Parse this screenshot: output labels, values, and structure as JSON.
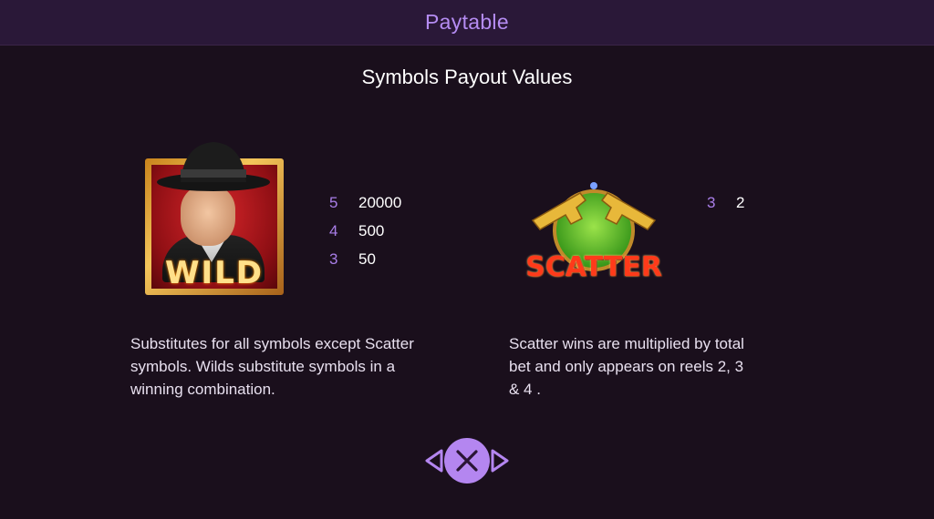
{
  "header": {
    "title": "Paytable"
  },
  "section": {
    "title": "Symbols Payout Values"
  },
  "wild": {
    "symbol_label": "WILD",
    "payouts": [
      {
        "count": "5",
        "value": "20000"
      },
      {
        "count": "4",
        "value": "500"
      },
      {
        "count": "3",
        "value": "50"
      }
    ],
    "description": "Substitutes for all symbols except Scatter symbols. Wilds substitute symbols in a winning combination."
  },
  "scatter": {
    "symbol_label": "SCATTER",
    "payouts": [
      {
        "count": "3",
        "value": "2"
      }
    ],
    "description": "Scatter wins are multiplied by total bet and only appears on reels 2, 3 & 4 ."
  },
  "nav": {
    "prev_icon": "chevron-left-icon",
    "close_icon": "close-icon",
    "next_icon": "chevron-right-icon"
  },
  "colors": {
    "header_bg": "#2a1838",
    "page_bg": "#1a0f1c",
    "accent": "#b58cf2",
    "count_color": "#a97ee8"
  }
}
